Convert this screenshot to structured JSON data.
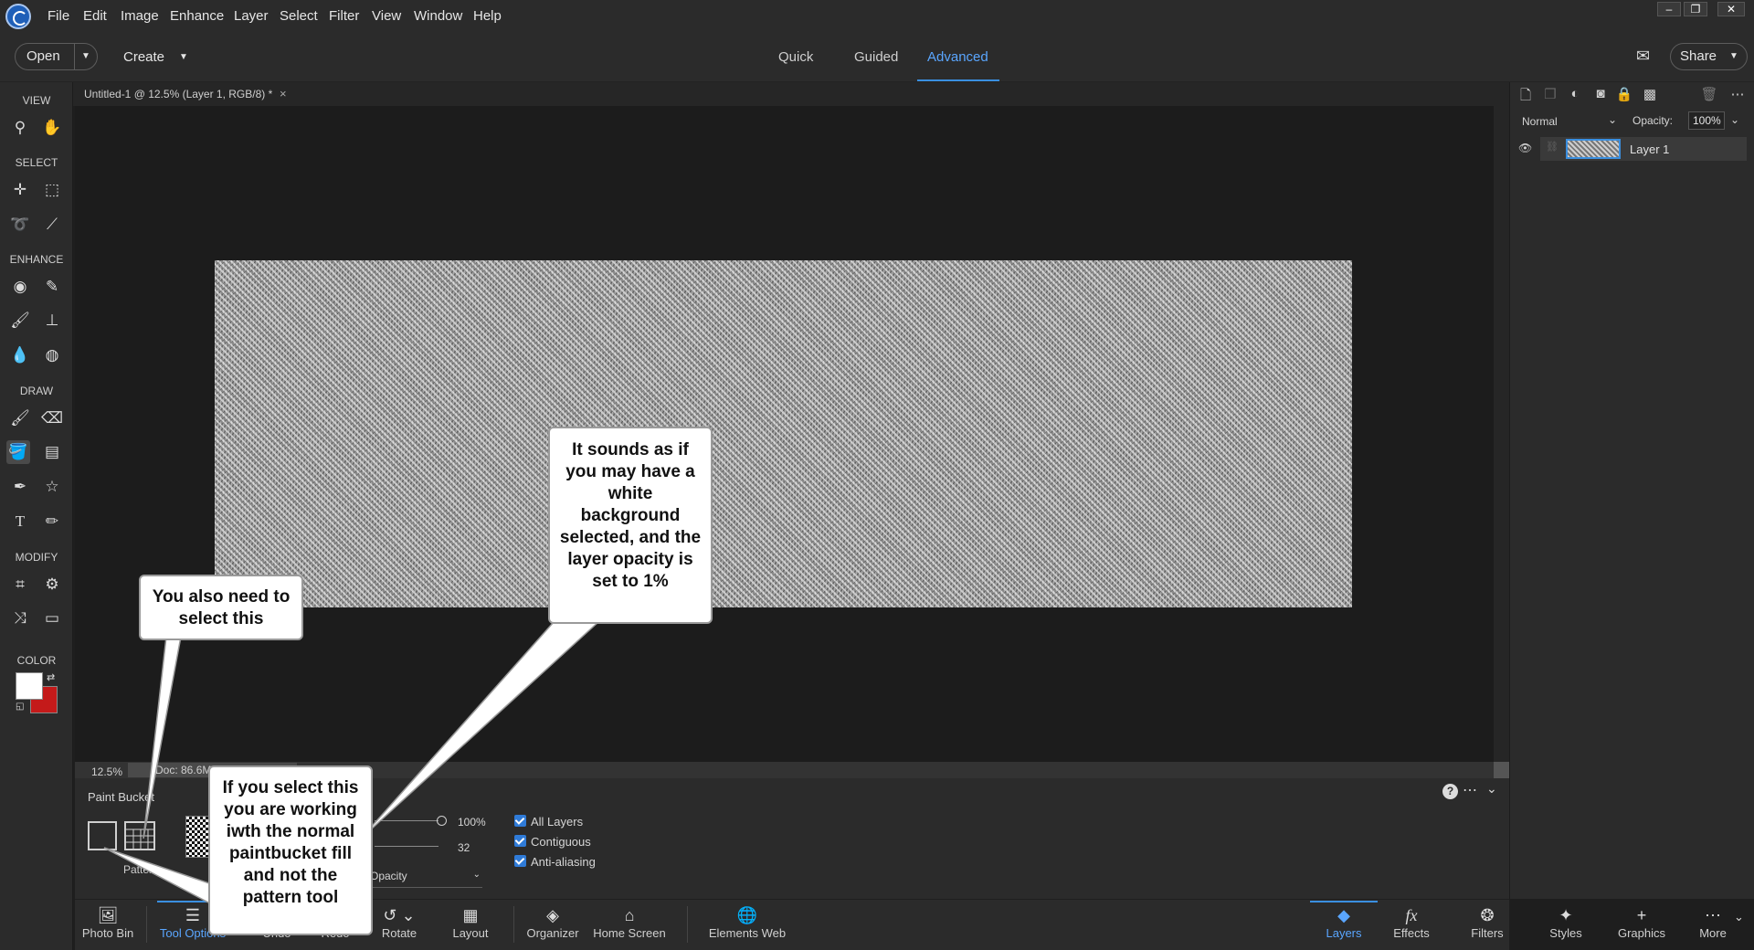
{
  "menubar": {
    "items": [
      "File",
      "Edit",
      "Image",
      "Enhance",
      "Layer",
      "Select",
      "Filter",
      "View",
      "Window",
      "Help"
    ],
    "window_controls": [
      "–",
      "❐",
      "✕"
    ]
  },
  "topbar": {
    "open_label": "Open",
    "create_label": "Create",
    "modes": [
      "Quick",
      "Guided",
      "Advanced"
    ],
    "active_mode": "Advanced",
    "share_label": "Share"
  },
  "document": {
    "tab_title": "Untitled-1 @ 12.5% (Layer 1, RGB/8) *",
    "tab_close": "×",
    "zoom": "12.5%",
    "doc_info": "Doc: 86.6M"
  },
  "toolbar": {
    "sections": [
      "VIEW",
      "SELECT",
      "ENHANCE",
      "DRAW",
      "MODIFY",
      "COLOR"
    ],
    "foreground_color": "#ffffff",
    "background_color": "#c41a1a"
  },
  "tool_options": {
    "title": "Paint Bucket",
    "pattern_label": "Pattern",
    "opacity_value": "100%",
    "tolerance_value": "32",
    "mode_value": "Opacity",
    "checkboxes": [
      "All Layers",
      "Contiguous",
      "Anti-aliasing"
    ]
  },
  "bottombar": {
    "left_items": [
      "Photo Bin",
      "Tool Options",
      "Undo",
      "Redo",
      "Rotate",
      "Layout",
      "Organizer",
      "Home Screen",
      "Elements Web"
    ],
    "right_items": [
      "Layers",
      "Effects",
      "Filters",
      "Styles",
      "Graphics",
      "More"
    ],
    "active_left": "Tool Options",
    "active_right": "Layers"
  },
  "layers_panel": {
    "blend_mode": "Normal",
    "opacity_label": "Opacity:",
    "opacity_value": "100%",
    "layer_name": "Layer 1"
  },
  "callouts": {
    "top": "It sounds as if you may have a white background selected, and the layer opacity is set to 1%",
    "left": "You also need to select this",
    "bottom": "If you select this you are working iwth the normal paintbucket fill and not the pattern tool"
  },
  "accent_color": "#3a8fe0"
}
